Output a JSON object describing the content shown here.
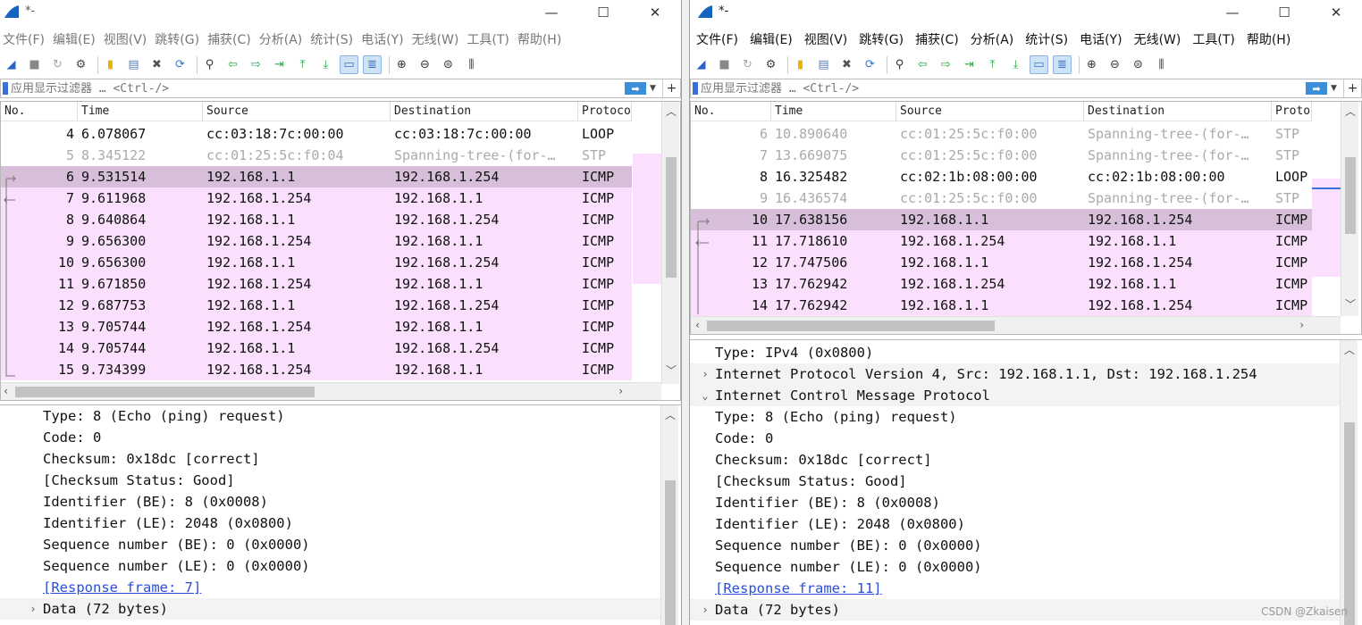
{
  "left": {
    "title": "*-",
    "menu": [
      "文件(F)",
      "编辑(E)",
      "视图(V)",
      "跳转(G)",
      "捕获(C)",
      "分析(A)",
      "统计(S)",
      "电话(Y)",
      "无线(W)",
      "工具(T)",
      "帮助(H)"
    ],
    "filter_placeholder": "应用显示过滤器 … <Ctrl-/>",
    "columns": [
      "No.",
      "Time",
      "Source",
      "Destination",
      "Protoco"
    ],
    "rows": [
      {
        "no": "4",
        "time": "6.078067",
        "src": "cc:03:18:7c:00:00",
        "dst": "cc:03:18:7c:00:00",
        "proto": "LOOP",
        "style": "plain"
      },
      {
        "no": "5",
        "time": "8.345122",
        "src": "cc:01:25:5c:f0:04",
        "dst": "Spanning-tree-(for-…",
        "proto": "STP",
        "style": "muted"
      },
      {
        "no": "6",
        "time": "9.531514",
        "src": "192.168.1.1",
        "dst": "192.168.1.254",
        "proto": "ICMP",
        "style": "sel"
      },
      {
        "no": "7",
        "time": "9.611968",
        "src": "192.168.1.254",
        "dst": "192.168.1.1",
        "proto": "ICMP",
        "style": "pink"
      },
      {
        "no": "8",
        "time": "9.640864",
        "src": "192.168.1.1",
        "dst": "192.168.1.254",
        "proto": "ICMP",
        "style": "pink"
      },
      {
        "no": "9",
        "time": "9.656300",
        "src": "192.168.1.254",
        "dst": "192.168.1.1",
        "proto": "ICMP",
        "style": "pink"
      },
      {
        "no": "10",
        "time": "9.656300",
        "src": "192.168.1.1",
        "dst": "192.168.1.254",
        "proto": "ICMP",
        "style": "pink"
      },
      {
        "no": "11",
        "time": "9.671850",
        "src": "192.168.1.254",
        "dst": "192.168.1.1",
        "proto": "ICMP",
        "style": "pink"
      },
      {
        "no": "12",
        "time": "9.687753",
        "src": "192.168.1.1",
        "dst": "192.168.1.254",
        "proto": "ICMP",
        "style": "pink"
      },
      {
        "no": "13",
        "time": "9.705744",
        "src": "192.168.1.254",
        "dst": "192.168.1.1",
        "proto": "ICMP",
        "style": "pink"
      },
      {
        "no": "14",
        "time": "9.705744",
        "src": "192.168.1.1",
        "dst": "192.168.1.254",
        "proto": "ICMP",
        "style": "pink"
      },
      {
        "no": "15",
        "time": "9.734399",
        "src": "192.168.1.254",
        "dst": "192.168.1.1",
        "proto": "ICMP",
        "style": "pink"
      }
    ],
    "details": [
      {
        "text": "Type: 8 (Echo (ping) request)",
        "indent": 2
      },
      {
        "text": "Code: 0",
        "indent": 2
      },
      {
        "text": "Checksum: 0x18dc [correct]",
        "indent": 2
      },
      {
        "text": "[Checksum Status: Good]",
        "indent": 2
      },
      {
        "text": "Identifier (BE): 8 (0x0008)",
        "indent": 2
      },
      {
        "text": "Identifier (LE): 2048 (0x0800)",
        "indent": 2
      },
      {
        "text": "Sequence number (BE): 0 (0x0000)",
        "indent": 2
      },
      {
        "text": "Sequence number (LE): 0 (0x0000)",
        "indent": 2
      },
      {
        "text": "[Response frame: 7]",
        "indent": 2,
        "link": true
      },
      {
        "text": "Data (72 bytes)",
        "indent": 1,
        "toggle": "›",
        "sect": true
      }
    ]
  },
  "right": {
    "title": "*-",
    "menu": [
      "文件(F)",
      "编辑(E)",
      "视图(V)",
      "跳转(G)",
      "捕获(C)",
      "分析(A)",
      "统计(S)",
      "电话(Y)",
      "无线(W)",
      "工具(T)",
      "帮助(H)"
    ],
    "filter_placeholder": "应用显示过滤器 … <Ctrl-/>",
    "columns": [
      "No.",
      "Time",
      "Source",
      "Destination",
      "Proto"
    ],
    "rows": [
      {
        "no": "6",
        "time": "10.890640",
        "src": "cc:01:25:5c:f0:00",
        "dst": "Spanning-tree-(for-…",
        "proto": "STP",
        "style": "muted"
      },
      {
        "no": "7",
        "time": "13.669075",
        "src": "cc:01:25:5c:f0:00",
        "dst": "Spanning-tree-(for-…",
        "proto": "STP",
        "style": "muted"
      },
      {
        "no": "8",
        "time": "16.325482",
        "src": "cc:02:1b:08:00:00",
        "dst": "cc:02:1b:08:00:00",
        "proto": "LOOP",
        "style": "plain"
      },
      {
        "no": "9",
        "time": "16.436574",
        "src": "cc:01:25:5c:f0:00",
        "dst": "Spanning-tree-(for-…",
        "proto": "STP",
        "style": "muted"
      },
      {
        "no": "10",
        "time": "17.638156",
        "src": "192.168.1.1",
        "dst": "192.168.1.254",
        "proto": "ICMP",
        "style": "sel"
      },
      {
        "no": "11",
        "time": "17.718610",
        "src": "192.168.1.254",
        "dst": "192.168.1.1",
        "proto": "ICMP",
        "style": "pink"
      },
      {
        "no": "12",
        "time": "17.747506",
        "src": "192.168.1.1",
        "dst": "192.168.1.254",
        "proto": "ICMP",
        "style": "pink"
      },
      {
        "no": "13",
        "time": "17.762942",
        "src": "192.168.1.254",
        "dst": "192.168.1.1",
        "proto": "ICMP",
        "style": "pink"
      },
      {
        "no": "14",
        "time": "17.762942",
        "src": "192.168.1.1",
        "dst": "192.168.1.254",
        "proto": "ICMP",
        "style": "pink"
      }
    ],
    "details": [
      {
        "text": "Type: IPv4 (0x0800)",
        "indent": 2
      },
      {
        "text": "Internet Protocol Version 4, Src: 192.168.1.1, Dst: 192.168.1.254",
        "indent": 1,
        "toggle": "›",
        "sect": true
      },
      {
        "text": "Internet Control Message Protocol",
        "indent": 1,
        "toggle": "⌄",
        "sect": true
      },
      {
        "text": "Type: 8 (Echo (ping) request)",
        "indent": 2
      },
      {
        "text": "Code: 0",
        "indent": 2
      },
      {
        "text": "Checksum: 0x18dc [correct]",
        "indent": 2
      },
      {
        "text": "[Checksum Status: Good]",
        "indent": 2
      },
      {
        "text": "Identifier (BE): 8 (0x0008)",
        "indent": 2
      },
      {
        "text": "Identifier (LE): 2048 (0x0800)",
        "indent": 2
      },
      {
        "text": "Sequence number (BE): 0 (0x0000)",
        "indent": 2
      },
      {
        "text": "Sequence number (LE): 0 (0x0000)",
        "indent": 2
      },
      {
        "text": "[Response frame: 11]",
        "indent": 2,
        "link": true
      },
      {
        "text": "Data (72 bytes)",
        "indent": 1,
        "toggle": "›",
        "sect": true
      }
    ],
    "watermark": "CSDN @Zkaisen"
  },
  "colors": {
    "icmp_row": "#fae0fc",
    "selected_row": "#d7bfd9",
    "link": "#2a4fd6",
    "accent": "#3b6fd8"
  }
}
